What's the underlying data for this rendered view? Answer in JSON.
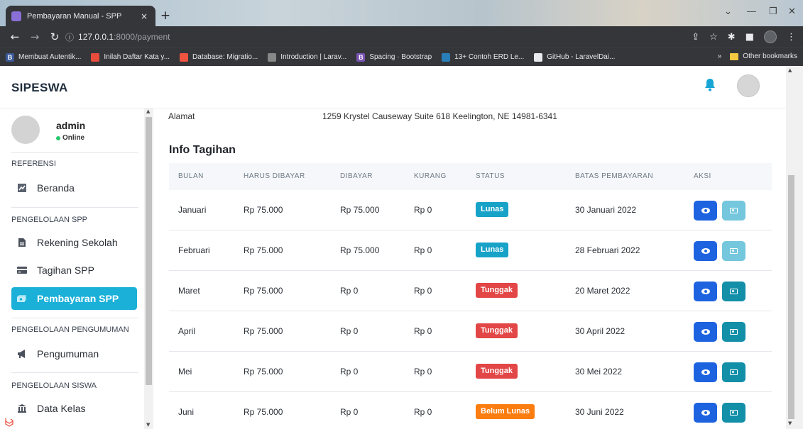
{
  "browser": {
    "tab_title": "Pembayaran Manual - SPP",
    "tab_close": "×",
    "new_tab": "+",
    "url_host": "127.0.0.1",
    "url_rest": ":8000/payment",
    "bookmarks": [
      {
        "label": "Membuat Autentik...",
        "color": "#3b5998",
        "icon": "B"
      },
      {
        "label": "Inilah Daftar Kata y...",
        "color": "#e74c3c",
        "icon": ""
      },
      {
        "label": "Database: Migratio...",
        "color": "#f05340",
        "icon": ""
      },
      {
        "label": "Introduction | Larav...",
        "color": "#888888",
        "icon": ""
      },
      {
        "label": "Spacing · Bootstrap",
        "color": "#7952b3",
        "icon": "B"
      },
      {
        "label": "13+ Contoh ERD Le...",
        "color": "#2980b9",
        "icon": ""
      },
      {
        "label": "GitHub - LaravelDai...",
        "color": "#e8eaed",
        "icon": ""
      }
    ],
    "bookmarks_more": "»",
    "other_bookmarks": "Other bookmarks"
  },
  "app": {
    "brand": "SIPESWA"
  },
  "sidebar": {
    "user_name": "admin",
    "user_status": "Online",
    "sections": [
      {
        "heading": "REFERENSI",
        "items": [
          {
            "label": "Beranda",
            "icon": "chart-icon",
            "active": false
          }
        ]
      },
      {
        "heading": "PENGELOLAAN SPP",
        "items": [
          {
            "label": "Rekening Sekolah",
            "icon": "file-icon",
            "active": false
          },
          {
            "label": "Tagihan SPP",
            "icon": "card-icon",
            "active": false
          },
          {
            "label": "Pembayaran SPP",
            "icon": "money-icon",
            "active": true
          }
        ]
      },
      {
        "heading": "PENGELOLAAN PENGUMUMAN",
        "items": [
          {
            "label": "Pengumuman",
            "icon": "megaphone-icon",
            "active": false
          }
        ]
      },
      {
        "heading": "PENGELOLAAN SISWA",
        "items": [
          {
            "label": "Data Kelas",
            "icon": "building-icon",
            "active": false
          }
        ]
      }
    ]
  },
  "student": {
    "address_label": "Alamat",
    "address_value": "1259 Krystel Causeway Suite 618 Keelington, NE 14981-6341"
  },
  "billing": {
    "title": "Info Tagihan",
    "columns": [
      "BULAN",
      "HARUS DIBAYAR",
      "DIBAYAR",
      "KURANG",
      "STATUS",
      "BATAS PEMBAYARAN",
      "AKSI"
    ],
    "rows": [
      {
        "month": "Januari",
        "due": "Rp 75.000",
        "paid": "Rp 75.000",
        "less": "Rp 0",
        "status": "Lunas",
        "status_color": "#17a2c8",
        "deadline": "30 Januari 2022",
        "pay_color": "#74c7dc"
      },
      {
        "month": "Februari",
        "due": "Rp 75.000",
        "paid": "Rp 75.000",
        "less": "Rp 0",
        "status": "Lunas",
        "status_color": "#17a2c8",
        "deadline": "28 Februari 2022",
        "pay_color": "#74c7dc"
      },
      {
        "month": "Maret",
        "due": "Rp 75.000",
        "paid": "Rp 0",
        "less": "Rp 0",
        "status": "Tunggak",
        "status_color": "#e24646",
        "deadline": "20 Maret 2022",
        "pay_color": "#138fa8"
      },
      {
        "month": "April",
        "due": "Rp 75.000",
        "paid": "Rp 0",
        "less": "Rp 0",
        "status": "Tunggak",
        "status_color": "#e24646",
        "deadline": "30 April 2022",
        "pay_color": "#138fa8"
      },
      {
        "month": "Mei",
        "due": "Rp 75.000",
        "paid": "Rp 0",
        "less": "Rp 0",
        "status": "Tunggak",
        "status_color": "#e24646",
        "deadline": "30 Mei 2022",
        "pay_color": "#138fa8"
      },
      {
        "month": "Juni",
        "due": "Rp 75.000",
        "paid": "Rp 0",
        "less": "Rp 0",
        "status": "Belum Lunas",
        "status_color": "#fb7d10",
        "deadline": "30 Juni 2022",
        "pay_color": "#138fa8"
      }
    ]
  }
}
